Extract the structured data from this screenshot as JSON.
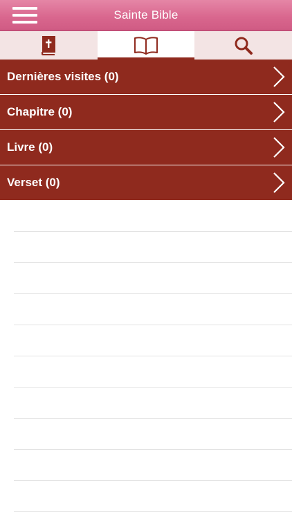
{
  "header": {
    "title": "Sainte Bible",
    "menu_icon": "hamburger-menu-icon"
  },
  "tabs": [
    {
      "icon": "bible-book-icon",
      "active": false
    },
    {
      "icon": "open-book-icon",
      "active": true
    },
    {
      "icon": "search-icon",
      "active": false
    }
  ],
  "list": {
    "rows": [
      {
        "label": "Dernières visites (0)"
      },
      {
        "label": "Chapitre (0)"
      },
      {
        "label": "Livre (0)"
      },
      {
        "label": "Verset (0)"
      }
    ]
  },
  "colors": {
    "header_pink": "#d9678e",
    "row_red": "#8f2a1e",
    "tabbar_bg": "#f3e4e4",
    "icon_red": "#8f2a1e"
  }
}
